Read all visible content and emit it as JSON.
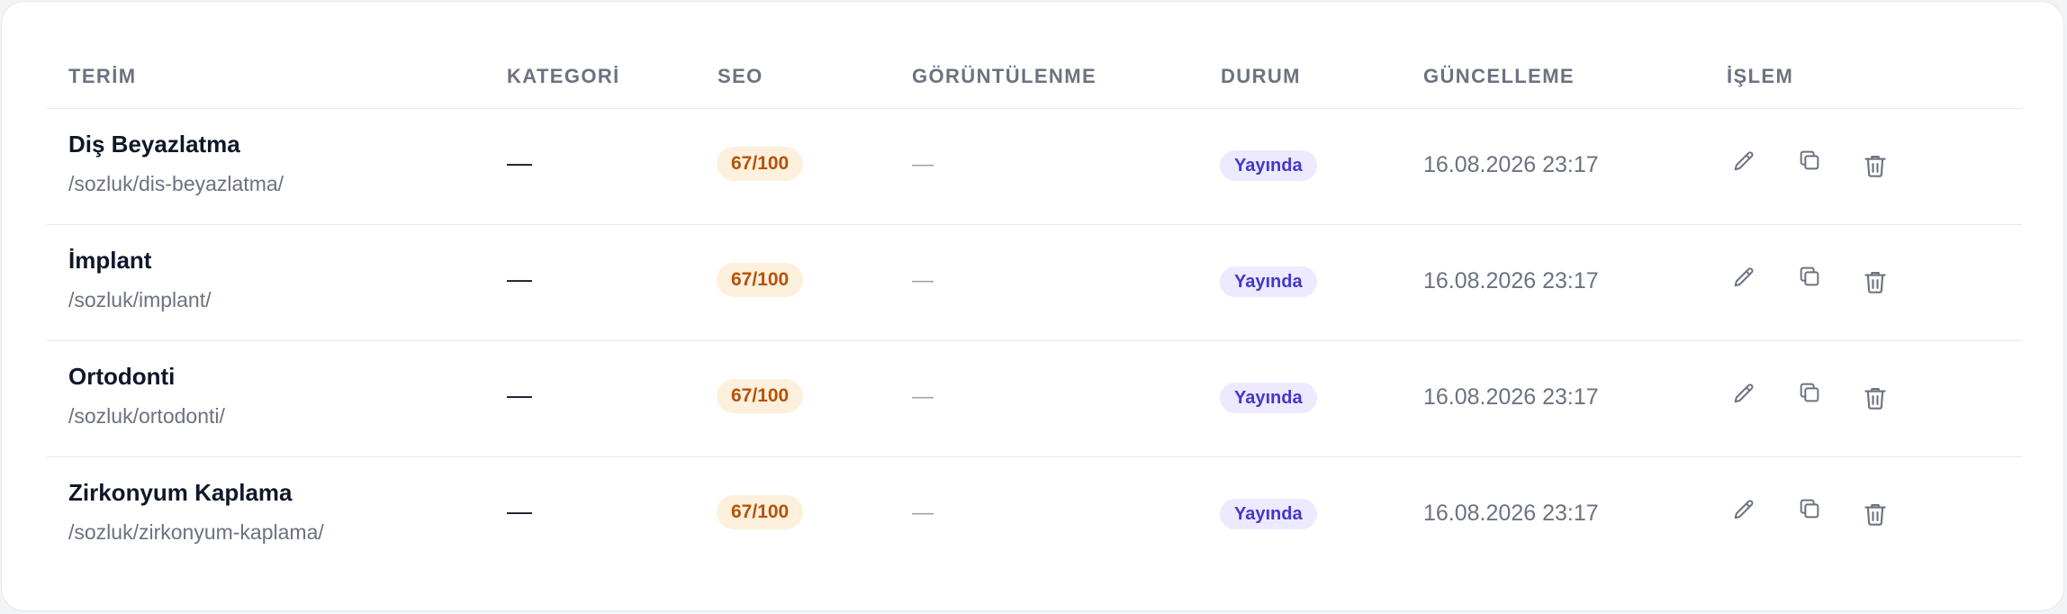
{
  "table": {
    "headers": {
      "term": "TERİM",
      "category": "KATEGORİ",
      "seo": "SEO",
      "views": "GÖRÜNTÜLENME",
      "status": "DURUM",
      "updated": "GÜNCELLEME",
      "actions": "İŞLEM"
    },
    "rows": [
      {
        "title": "Diş Beyazlatma",
        "slug": "/sozluk/dis-beyazlatma/",
        "category": "—",
        "seo": "67/100",
        "views": "—",
        "status": "Yayında",
        "updated": "16.08.2026 23:17"
      },
      {
        "title": "İmplant",
        "slug": "/sozluk/implant/",
        "category": "—",
        "seo": "67/100",
        "views": "—",
        "status": "Yayında",
        "updated": "16.08.2026 23:17"
      },
      {
        "title": "Ortodonti",
        "slug": "/sozluk/ortodonti/",
        "category": "—",
        "seo": "67/100",
        "views": "—",
        "status": "Yayında",
        "updated": "16.08.2026 23:17"
      },
      {
        "title": "Zirkonyum Kaplama",
        "slug": "/sozluk/zirkonyum-kaplama/",
        "category": "—",
        "seo": "67/100",
        "views": "—",
        "status": "Yayında",
        "updated": "16.08.2026 23:17"
      }
    ],
    "row_actions": [
      "pencil-icon",
      "copy-icon",
      "trash-icon"
    ]
  },
  "colors": {
    "seo_badge_bg": "#fdf0dc",
    "seo_badge_text": "#b45309",
    "status_badge_bg": "#ede9fe",
    "status_badge_text": "#4338ca",
    "icon": "#6b7280"
  }
}
